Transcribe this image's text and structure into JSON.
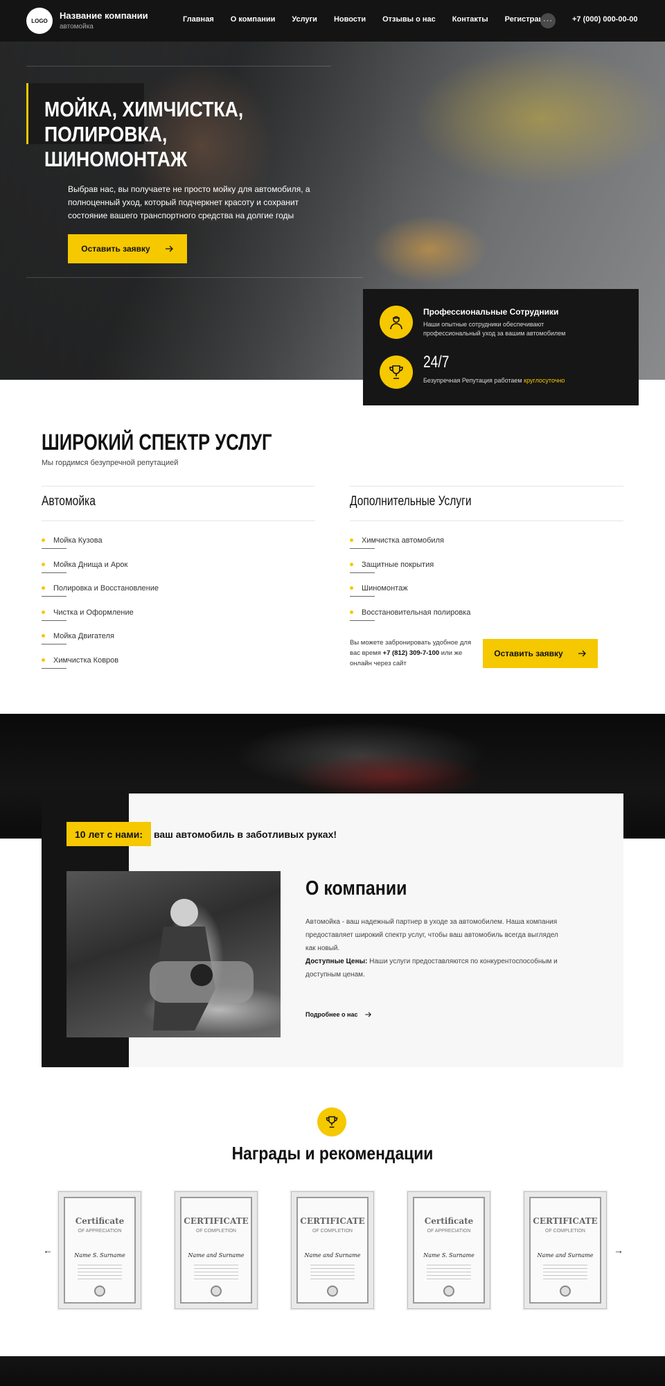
{
  "header": {
    "logo": "LOGO",
    "company_name": "Название компании",
    "company_sub": "автомойка",
    "nav": [
      "Главная",
      "О компании",
      "Услуги",
      "Новости",
      "Отзывы о нас",
      "Контакты",
      "Регистрация"
    ],
    "more": "···",
    "phone": "+7 (000) 000-00-00"
  },
  "hero": {
    "title": "МОЙКА, ХИМЧИСТКА, ПОЛИРОВКА, ШИНОМОНТАЖ",
    "description": "Выбрав нас, вы получаете не просто мойку для автомобиля, а полноценный уход, который подчеркнет красоту и сохранит состояние вашего транспортного средства на долгие годы",
    "button": "Оставить заявку"
  },
  "features": {
    "item1_title": "Профессиональные Сотрудники",
    "item1_text": "Наши опытные сотрудники обеспечивают профессиональный уход за вашим автомобилем",
    "item2_title": "24/7",
    "item2_text": "Безупречная Репутация работаем",
    "item2_highlight": "круглосуточно"
  },
  "services": {
    "title": "ШИРОКИЙ СПЕКТР УСЛУГ",
    "subtitle": "Мы гордимся безупречной репутацией",
    "col1_title": "Автомойка",
    "col1_items": [
      "Мойка Кузова",
      "Мойка Днища и Арок",
      "Полировка и Восстановление",
      "Чистка и Оформление",
      "Мойка Двигателя",
      "Химчистка Ковров"
    ],
    "col2_title": "Дополнительные Услуги",
    "col2_items": [
      "Химчистка автомобиля",
      "Защитные покрытия",
      "Шиномонтаж",
      "Восстановительная полировка"
    ],
    "book_text_before": "Вы можете забронировать удобное для вас время",
    "book_phone": "+7 (812) 309-7-100",
    "book_text_after": "или же онлайн через сайт",
    "button": "Оставить заявку"
  },
  "about": {
    "badge_highlight": "10 лет с нами:",
    "badge_rest": "ваш автомобиль в заботливых руках!",
    "title": "О компании",
    "p1": "Автомойка - ваш надежный партнер в уходе за автомобилем. Наша компания предоставляет широкий спектр услуг, чтобы ваш автомобиль всегда выглядел как новый.",
    "p2_label": "Доступные Цены:",
    "p2_text": "Наши услуги предоставляются по конкурентоспособным и доступным ценам.",
    "more_link": "Подробнее о нас"
  },
  "awards": {
    "title": "Награды и рекомендации",
    "certs": [
      {
        "title": "Certificate",
        "sub": "OF APPRECIATION",
        "name": "Name S. Surname"
      },
      {
        "title": "CERTIFICATE",
        "sub": "OF COMPLETION",
        "name": "Name and Surname"
      },
      {
        "title": "CERTIFICATE",
        "sub": "OF COMPLETION",
        "name": "Name and Surname"
      },
      {
        "title": "Certificate",
        "sub": "OF APPRECIATION",
        "name": "Name S. Surname"
      },
      {
        "title": "CERTIFICATE",
        "sub": "OF COMPLETION",
        "name": "Name and Surname"
      }
    ],
    "prev": "←",
    "next": "→"
  },
  "colors": {
    "accent": "#f5c800",
    "dark": "#141414"
  },
  "icons": [
    "arrow-right-icon",
    "worker-icon",
    "trophy-icon",
    "award-icon"
  ]
}
